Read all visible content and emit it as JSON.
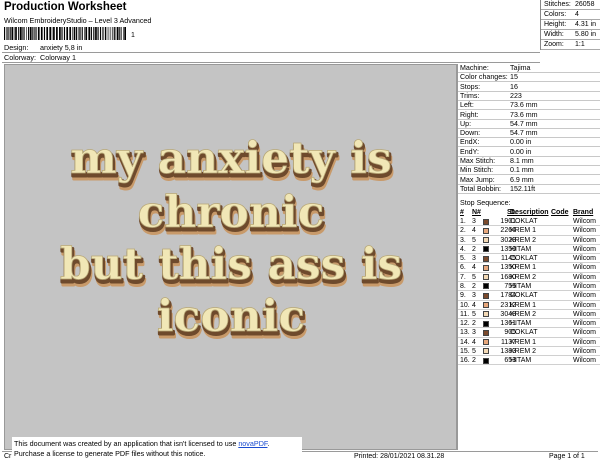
{
  "header": {
    "title": "Production Worksheet",
    "subtitle": "Wilcom EmbroideryStudio – Level 3 Advanced",
    "barcode_digit": "1",
    "design_label": "Design:",
    "design_value": "anxiety 5,8 in",
    "colorway_label": "Colorway:",
    "colorway_value": "Colorway 1"
  },
  "stats": [
    {
      "k": "Stitches:",
      "v": "26058"
    },
    {
      "k": "Colors:",
      "v": "4"
    },
    {
      "k": "Height:",
      "v": "4.31 in"
    },
    {
      "k": "Width:",
      "v": "5.80 in"
    },
    {
      "k": "Zoom:",
      "v": "1:1"
    }
  ],
  "design_text": {
    "lines": [
      "my anxiety is",
      "chronic",
      "but this ass is",
      "iconic"
    ],
    "colors": {
      "fill": "#f1e7b6",
      "shadow1": "#6e4a2c",
      "shadow2": "#c89a6a"
    }
  },
  "machine_info": [
    {
      "k": "Machine:",
      "v": "Tajima"
    },
    {
      "k": "Color changes:",
      "v": "15"
    },
    {
      "k": "Stops:",
      "v": "16"
    },
    {
      "k": "Trims:",
      "v": "223"
    },
    {
      "k": "Left:",
      "v": "73.6 mm"
    },
    {
      "k": "Right:",
      "v": "73.6 mm"
    },
    {
      "k": "Up:",
      "v": "54.7 mm"
    },
    {
      "k": "Down:",
      "v": "54.7 mm"
    },
    {
      "k": "EndX:",
      "v": "0.00 in"
    },
    {
      "k": "EndY:",
      "v": "0.00 in"
    },
    {
      "k": "Max Stitch:",
      "v": "8.1 mm"
    },
    {
      "k": "Min Stitch:",
      "v": "0.1 mm"
    },
    {
      "k": "Max Jump:",
      "v": "6.9 mm"
    },
    {
      "k": "Total Bobbin:",
      "v": "152.11ft"
    }
  ],
  "sequence": {
    "title": "Stop Sequence:",
    "headers": {
      "num": "#",
      "n": "N#",
      "st": "St.",
      "desc": "Description",
      "code": "Code",
      "brand": "Brand"
    },
    "rows": [
      {
        "num": "1.",
        "n": "3",
        "color": "#7b4a2c",
        "st": "1901",
        "desc": "COKLAT",
        "code": "",
        "brand": "Wilcom"
      },
      {
        "num": "2.",
        "n": "4",
        "color": "#e7a77b",
        "st": "2264",
        "desc": "KREM 1",
        "code": "",
        "brand": "Wilcom"
      },
      {
        "num": "3.",
        "n": "5",
        "color": "#f3d9b5",
        "st": "3028",
        "desc": "KREM 2",
        "code": "",
        "brand": "Wilcom"
      },
      {
        "num": "4.",
        "n": "2",
        "color": "#000000",
        "st": "1350",
        "desc": "HITAM",
        "code": "",
        "brand": "Wilcom"
      },
      {
        "num": "5.",
        "n": "3",
        "color": "#7b4a2c",
        "st": "1145",
        "desc": "COKLAT",
        "code": "",
        "brand": "Wilcom"
      },
      {
        "num": "6.",
        "n": "4",
        "color": "#e7a77b",
        "st": "1350",
        "desc": "KREM 1",
        "code": "",
        "brand": "Wilcom"
      },
      {
        "num": "7.",
        "n": "5",
        "color": "#f3d9b5",
        "st": "1680",
        "desc": "KREM 2",
        "code": "",
        "brand": "Wilcom"
      },
      {
        "num": "8.",
        "n": "2",
        "color": "#000000",
        "st": "755",
        "desc": "HITAM",
        "code": "",
        "brand": "Wilcom"
      },
      {
        "num": "9.",
        "n": "3",
        "color": "#7b4a2c",
        "st": "1784",
        "desc": "COKLAT",
        "code": "",
        "brand": "Wilcom"
      },
      {
        "num": "10.",
        "n": "4",
        "color": "#e7a77b",
        "st": "2312",
        "desc": "KREM 1",
        "code": "",
        "brand": "Wilcom"
      },
      {
        "num": "11.",
        "n": "5",
        "color": "#f3d9b5",
        "st": "3048",
        "desc": "KREM 2",
        "code": "",
        "brand": "Wilcom"
      },
      {
        "num": "12.",
        "n": "2",
        "color": "#000000",
        "st": "1361",
        "desc": "HITAM",
        "code": "",
        "brand": "Wilcom"
      },
      {
        "num": "13.",
        "n": "3",
        "color": "#7b4a2c",
        "st": "905",
        "desc": "COKLAT",
        "code": "",
        "brand": "Wilcom"
      },
      {
        "num": "14.",
        "n": "4",
        "color": "#e7a77b",
        "st": "1137",
        "desc": "KREM 1",
        "code": "",
        "brand": "Wilcom"
      },
      {
        "num": "15.",
        "n": "5",
        "color": "#f3d9b5",
        "st": "1383",
        "desc": "KREM 2",
        "code": "",
        "brand": "Wilcom"
      },
      {
        "num": "16.",
        "n": "2",
        "color": "#000000",
        "st": "653",
        "desc": "HITAM",
        "code": "",
        "brand": "Wilcom"
      }
    ]
  },
  "footer": {
    "cr": "Cr",
    "printed": "Printed: 28/01/2021 08.31.28",
    "page": "Page 1 of 1",
    "notice_line1": "This document was created by an application that isn't licensed to use ",
    "notice_link": "novaPDF",
    "notice_line1_end": ".",
    "notice_line2": "Purchase a license to generate PDF files without this notice."
  }
}
